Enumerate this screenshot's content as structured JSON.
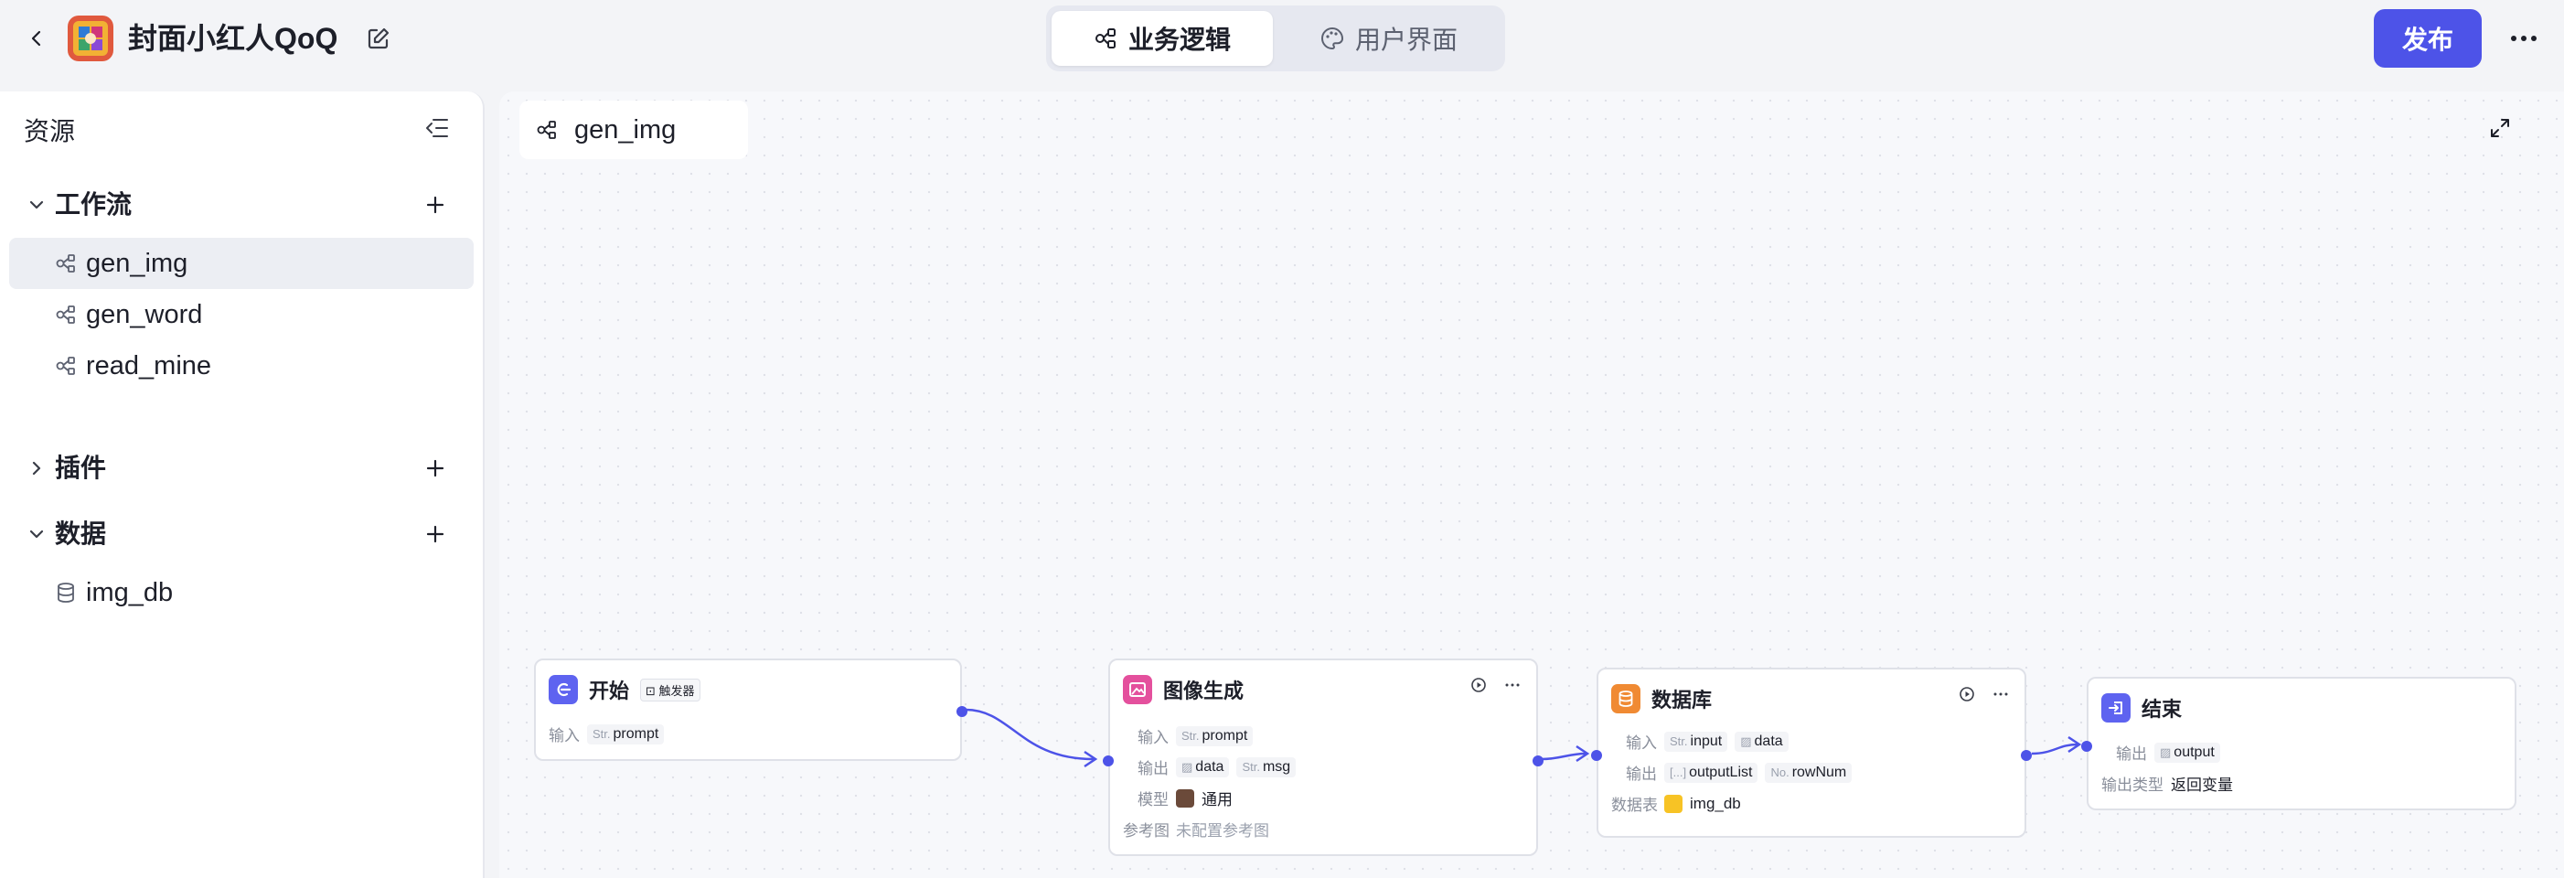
{
  "header": {
    "app_title": "封面小红人QoQ",
    "tabs": [
      {
        "label": "业务逻辑",
        "active": true
      },
      {
        "label": "用户界面",
        "active": false
      }
    ],
    "publish_label": "发布",
    "accent": "#4d53e8"
  },
  "sidebar": {
    "title": "资源",
    "sections": [
      {
        "label": "工作流",
        "expanded": true,
        "items": [
          {
            "label": "gen_img",
            "icon": "workflow-icon",
            "selected": true
          },
          {
            "label": "gen_word",
            "icon": "workflow-icon",
            "selected": false
          },
          {
            "label": "read_mine",
            "icon": "workflow-icon",
            "selected": false
          }
        ]
      },
      {
        "label": "插件",
        "expanded": false,
        "items": []
      },
      {
        "label": "数据",
        "expanded": true,
        "items": [
          {
            "label": "img_db",
            "icon": "database-icon",
            "selected": false
          }
        ]
      }
    ]
  },
  "canvas": {
    "tab_label": "gen_img",
    "nodes": {
      "start": {
        "title": "开始",
        "badge": "触发器",
        "input_label": "输入",
        "inputs": [
          {
            "type": "Str.",
            "name": "prompt"
          }
        ]
      },
      "image_gen": {
        "title": "图像生成",
        "input_label": "输入",
        "inputs": [
          {
            "type": "Str.",
            "name": "prompt"
          }
        ],
        "output_label": "输出",
        "outputs": [
          {
            "type": "img",
            "name": "data"
          },
          {
            "type": "Str.",
            "name": "msg"
          }
        ],
        "model_label": "模型",
        "model": "通用",
        "ref_label": "参考图",
        "ref_value": "未配置参考图"
      },
      "database": {
        "title": "数据库",
        "input_label": "输入",
        "inputs": [
          {
            "type": "Str.",
            "name": "input"
          },
          {
            "type": "img",
            "name": "data"
          }
        ],
        "output_label": "输出",
        "outputs": [
          {
            "type": "[...]",
            "name": "outputList"
          },
          {
            "type": "No.",
            "name": "rowNum"
          }
        ],
        "table_label": "数据表",
        "table": "img_db"
      },
      "end": {
        "title": "结束",
        "output_label": "输出",
        "outputs": [
          {
            "type": "img",
            "name": "output"
          }
        ],
        "output_type_label": "输出类型",
        "output_type": "返回变量"
      }
    }
  }
}
